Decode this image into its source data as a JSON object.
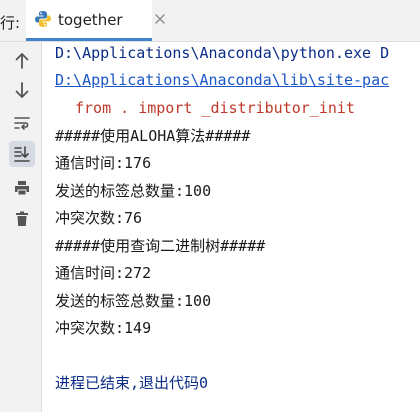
{
  "run": {
    "label": "行:"
  },
  "tab": {
    "label": "together"
  },
  "toolbar": {
    "tools": [
      "up-arrow-icon",
      "down-arrow-icon",
      "soft-wrap-icon",
      "scroll-to-end-icon",
      "print-icon",
      "trash-icon"
    ]
  },
  "console": {
    "lines": [
      "D:\\Applications\\Anaconda\\python.exe D",
      "D:\\Applications\\Anaconda\\lib\\site-pac",
      "from . import _distributor_init",
      "#####使用ALOHA算法#####",
      "通信时间:176",
      "发送的标签总数量:100",
      "冲突次数:76",
      "#####使用查询二进制树#####",
      "通信时间:272",
      "发送的标签总数量:100",
      "冲突次数:149",
      "",
      "进程已结束,退出代码0"
    ]
  },
  "colors": {
    "accent": "#4083c9",
    "command": "#0b2d88",
    "link": "#1a56c7",
    "warning": "#c0392b"
  }
}
